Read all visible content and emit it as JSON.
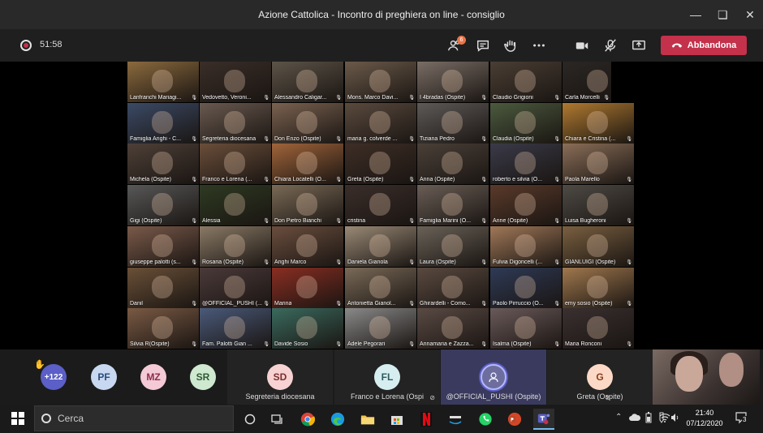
{
  "window": {
    "title": "Azione Cattolica - Incontro di preghiera on line - consiglio"
  },
  "toolbar": {
    "timer": "51:58",
    "participants_badge": "6",
    "leave_label": "Abbandona",
    "accent": "#c4314b"
  },
  "tiles": [
    [
      "Lanfranchi Mariagi...",
      "Vedovetto, Veroni...",
      "Alessandro Caligar...",
      "Mons. Marco Davi...",
      "I 4bradas (Ospite)",
      "Claudio Grigioni",
      "Carla Morcelli"
    ],
    [
      "Famiglia Arighi - C...",
      "Segreteria diocesana",
      "Don Enzo (Ospite)",
      "maria g. colverde ...",
      "Tiziana Pedro",
      "Claudia (Ospite)",
      "Chiara e Cristina (..."
    ],
    [
      "Michela (Ospite)",
      "Franco e Lorena (...",
      "Chiara Locatelli (O...",
      "Greta (Ospite)",
      "Anna (Ospite)",
      "roberto e silvia (O...",
      "Paola Marello"
    ],
    [
      "Gigi (Ospite)",
      "Alessia",
      "Don Pietro Bianchi",
      "cristina",
      "Famiglia Marini (O...",
      "Anne (Ospite)",
      "Luisa Bugheroni"
    ],
    [
      "giuseppe palotti (s...",
      "Rosaria (Ospite)",
      "Arighi Marco",
      "Daniela Gianola",
      "Laura (Ospite)",
      "Fulvia Digoncelli (...",
      "GIANLUIGI (Ospite)"
    ],
    [
      "Danil",
      "@OFFICIAL_PUSHI (...",
      "Marina",
      "Antonietta Gianol...",
      "Ghirardelli - Como...",
      "Paolo Pirruccio (O...",
      "emy sosio (Ospite)"
    ],
    [
      "Silvia R(Ospite)",
      "Fam. Palotti Gian ...",
      "Davide Sosio",
      "Adele Pegorari",
      "Annamaria e Zazza...",
      "Isalma (Ospite)",
      "Maria Ronconi"
    ]
  ],
  "tile_colors": [
    [
      "#8b6a3e",
      "#3a2e28",
      "#5d5448",
      "#6b5a4a",
      "#7a6e66",
      "#4a3e34",
      "#2b2724"
    ],
    [
      "#3b4a66",
      "#6a5a50",
      "#7a6250",
      "#5a4a3e",
      "#5e5a58",
      "#4b5a3e",
      "#b07a30"
    ],
    [
      "#4e4038",
      "#6a4e3a",
      "#a0643a",
      "#3e2e26",
      "#4a4038",
      "#3a3a48",
      "#8a6e58"
    ],
    [
      "#585858",
      "#2e3a22",
      "#7a6a56",
      "#3a2e2a",
      "#6a5e56",
      "#5a3a2a",
      "#4e4a44"
    ],
    [
      "#7a5a4a",
      "#8a7a66",
      "#6a4e3e",
      "#9a8a76",
      "#6a6258",
      "#a07858",
      "#7a6040"
    ],
    [
      "#6a5038",
      "#4a3a3a",
      "#8a2e22",
      "#7a6a58",
      "#5a4a40",
      "#2e3a56",
      "#a0784e"
    ],
    [
      "#7a5a44",
      "#4a5a7a",
      "#3a6a5e",
      "#8a8a8a",
      "#5a4a44",
      "#6a5a5a",
      "#3a3030"
    ]
  ],
  "roster": {
    "overflow_count": "+122",
    "chips": [
      {
        "initials": "PF",
        "bg": "#c7d8f0",
        "fg": "#2b4a7a"
      },
      {
        "initials": "MZ",
        "bg": "#f3cad6",
        "fg": "#8a2e4a"
      },
      {
        "initials": "SR",
        "bg": "#cfe8d0",
        "fg": "#2e5a34"
      }
    ],
    "named": [
      {
        "initials": "SD",
        "name": "Segreteria diocesana",
        "bg": "#f6d2d2",
        "fg": "#7a2e2e"
      },
      {
        "initials": "FL",
        "name": "Franco e Lorena (Ospi",
        "bg": "#d6eef0",
        "fg": "#2e5a60"
      },
      {
        "initials": "",
        "name": "@OFFICIAL_PUSHI (Ospite)",
        "bg": "#6e6e9e",
        "fg": "#fff"
      },
      {
        "initials": "G",
        "name": "Greta (Ospite)",
        "bg": "#fbd9c6",
        "fg": "#8a3e1a"
      }
    ]
  },
  "taskbar": {
    "search_placeholder": "Cerca",
    "time": "21:40",
    "date": "07/12/2020",
    "notifications": "3"
  }
}
